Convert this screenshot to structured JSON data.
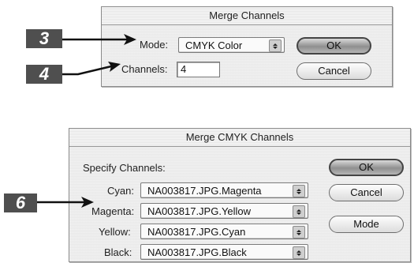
{
  "merge_dialog": {
    "title": "Merge Channels",
    "mode_label": "Mode:",
    "mode_value": "CMYK Color",
    "channels_label": "Channels:",
    "channels_value": "4",
    "ok_label": "OK",
    "cancel_label": "Cancel"
  },
  "merge_cmyk_dialog": {
    "title": "Merge CMYK Channels",
    "section_label": "Specify Channels:",
    "rows": [
      {
        "label": "Cyan:",
        "value": "NA003817.JPG.Magenta"
      },
      {
        "label": "Magenta:",
        "value": "NA003817.JPG.Yellow"
      },
      {
        "label": "Yellow:",
        "value": "NA003817.JPG.Cyan"
      },
      {
        "label": "Black:",
        "value": "NA003817.JPG.Black"
      }
    ],
    "ok_label": "OK",
    "cancel_label": "Cancel",
    "mode_label": "Mode"
  },
  "callouts": {
    "step3": "3",
    "step4": "4",
    "step6": "6"
  },
  "colors": {
    "callout_bg": "#4f4f4f",
    "dialog_bg": "#e9e9e9"
  }
}
